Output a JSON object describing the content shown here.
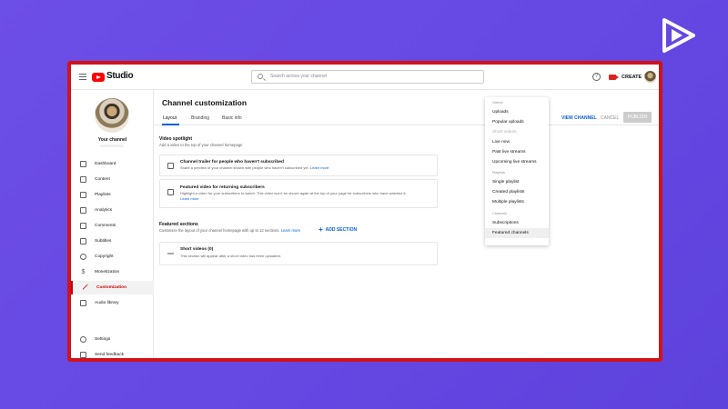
{
  "topbar": {
    "app_name": "Studio",
    "search_placeholder": "Search across your channel",
    "help_label": "?",
    "create_label": "CREATE"
  },
  "sidebar": {
    "channel_label": "Your channel",
    "items": [
      {
        "label": "Dashboard",
        "icon": "dashboard-icon"
      },
      {
        "label": "Content",
        "icon": "content-icon"
      },
      {
        "label": "Playlists",
        "icon": "playlists-icon"
      },
      {
        "label": "Analytics",
        "icon": "analytics-icon"
      },
      {
        "label": "Comments",
        "icon": "comments-icon"
      },
      {
        "label": "Subtitles",
        "icon": "subtitles-icon"
      },
      {
        "label": "Copyright",
        "icon": "copyright-icon"
      },
      {
        "label": "Monetization",
        "icon": "monetization-icon"
      },
      {
        "label": "Customization",
        "icon": "customization-icon",
        "active": true
      },
      {
        "label": "Audio library",
        "icon": "audio-library-icon"
      }
    ],
    "bottom_items": [
      {
        "label": "Settings",
        "icon": "settings-icon"
      },
      {
        "label": "Send feedback",
        "icon": "feedback-icon"
      }
    ]
  },
  "main": {
    "title": "Channel customization",
    "tabs": [
      {
        "label": "Layout",
        "active": true
      },
      {
        "label": "Branding"
      },
      {
        "label": "Basic info"
      }
    ],
    "actions": {
      "view_channel": "VIEW CHANNEL",
      "cancel": "CANCEL",
      "publish": "PUBLISH"
    },
    "video_spotlight": {
      "title": "Video spotlight",
      "description": "Add a video to the top of your channel homepage",
      "cards": [
        {
          "title": "Channel trailer for people who haven't subscribed",
          "description": "Share a preview of your channel shown with people who haven't subscribed yet.",
          "learn_more": "Learn more"
        },
        {
          "title": "Featured video for returning subscribers",
          "description": "Highlight a video for your subscribers to watch. This video won't be shown again at the top of your page for subscribers who have watched it.",
          "learn_more": "Learn more"
        }
      ]
    },
    "featured_sections": {
      "title": "Featured sections",
      "description": "Customize the layout of your channel homepage with up to 12 sections.",
      "learn_more": "Learn more",
      "add_section": "ADD SECTION",
      "sections": [
        {
          "title": "Short videos (0)",
          "description": "This section will appear after a short video has been uploaded."
        }
      ]
    }
  },
  "dropdown": {
    "groups": [
      {
        "label": "Videos",
        "items": [
          {
            "label": "Uploads"
          },
          {
            "label": "Popular uploads"
          },
          {
            "label": "Short videos",
            "disabled": true
          },
          {
            "label": "Live now"
          },
          {
            "label": "Past live streams"
          },
          {
            "label": "Upcoming live streams"
          }
        ]
      },
      {
        "label": "Playlists",
        "items": [
          {
            "label": "Single playlist"
          },
          {
            "label": "Created playlists"
          },
          {
            "label": "Multiple playlists"
          }
        ]
      },
      {
        "label": "Channels",
        "items": [
          {
            "label": "Subscriptions"
          },
          {
            "label": "Featured channels",
            "hover": true
          }
        ]
      }
    ]
  }
}
